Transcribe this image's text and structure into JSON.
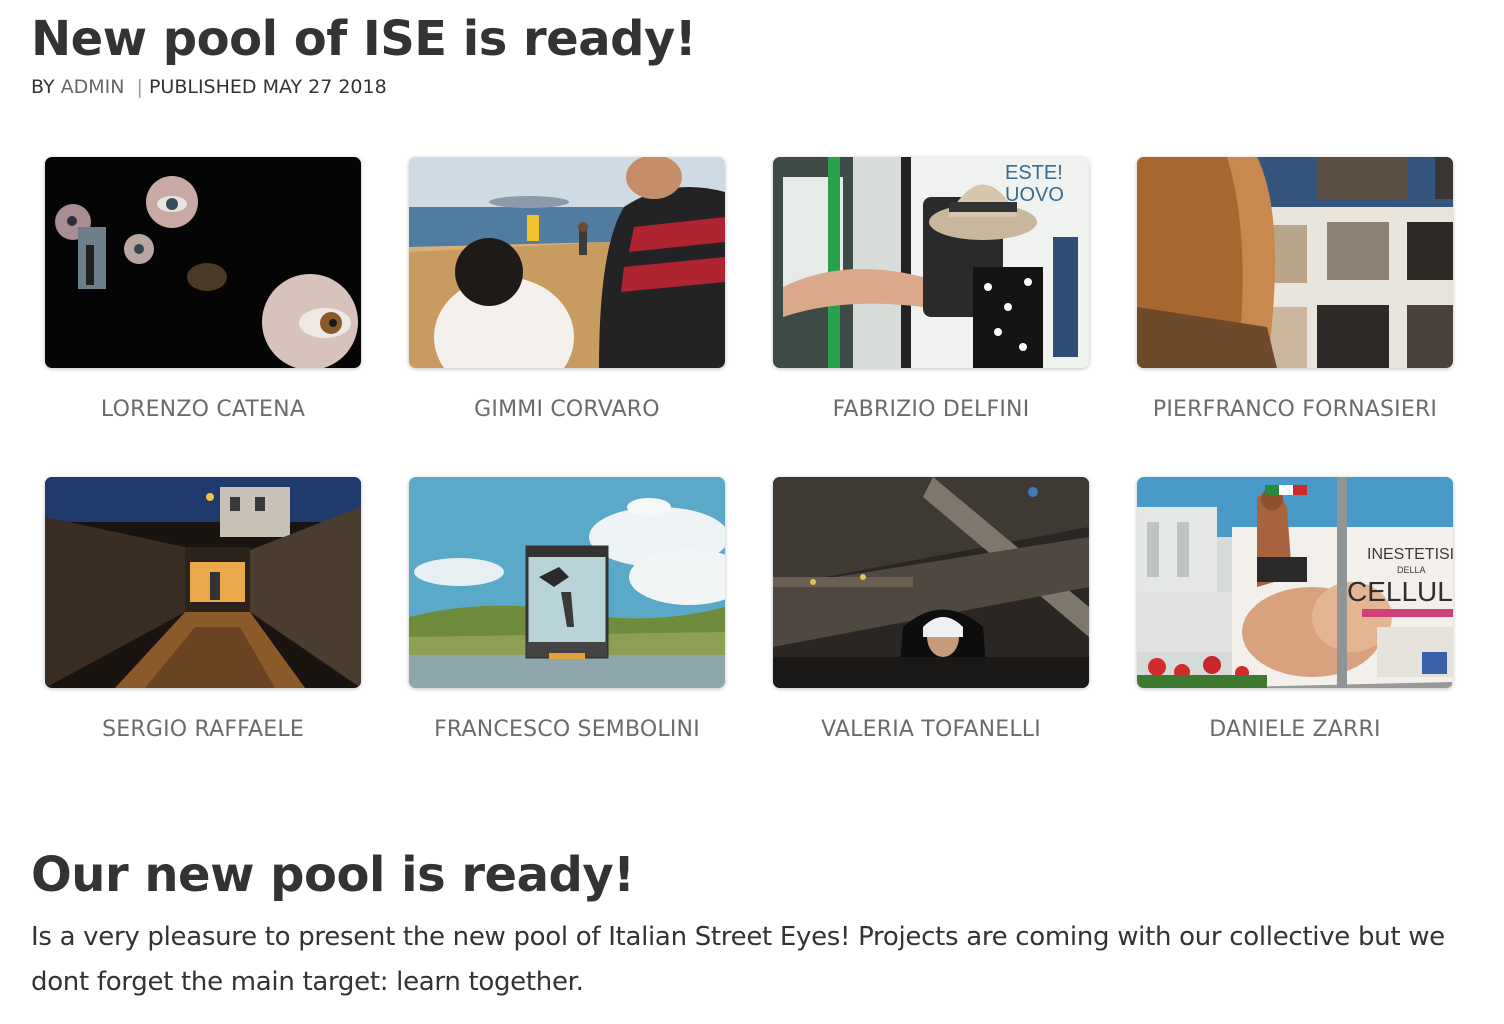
{
  "post": {
    "title": "New pool of ISE is ready!",
    "meta": {
      "by_prefix": "BY",
      "author": "ADMIN",
      "separator": "|",
      "published": "PUBLISHED MAY 27 2018"
    }
  },
  "gallery": [
    {
      "name": "LORENZO CATENA",
      "thumb": "eyes-on-black"
    },
    {
      "name": "GIMMI CORVARO",
      "thumb": "boy-on-beach"
    },
    {
      "name": "FABRIZIO DELFINI",
      "thumb": "hat-in-mirror"
    },
    {
      "name": "PIERFRANCO FORNASIERI",
      "thumb": "woman-at-exhibition"
    },
    {
      "name": "SERGIO RAFFAELE",
      "thumb": "night-stairway"
    },
    {
      "name": "FRANCESCO SEMBOLINI",
      "thumb": "truck-in-landscape"
    },
    {
      "name": "VALERIA TOFANELLI",
      "thumb": "nun-on-escalator"
    },
    {
      "name": "DANIELE ZARRI",
      "thumb": "man-and-billboard"
    }
  ],
  "billboard": {
    "line1": "INESTETISI",
    "line2": "DELLA",
    "line3": "CELLUL"
  },
  "mirror_sign": {
    "line1": "ESTE!",
    "line2": "UOVO"
  },
  "section": {
    "title": "Our new pool is ready!",
    "body": "Is a very pleasure to present the new pool of Italian Street Eyes! Projects are coming with our collective but we dont forget the main target: learn together."
  }
}
